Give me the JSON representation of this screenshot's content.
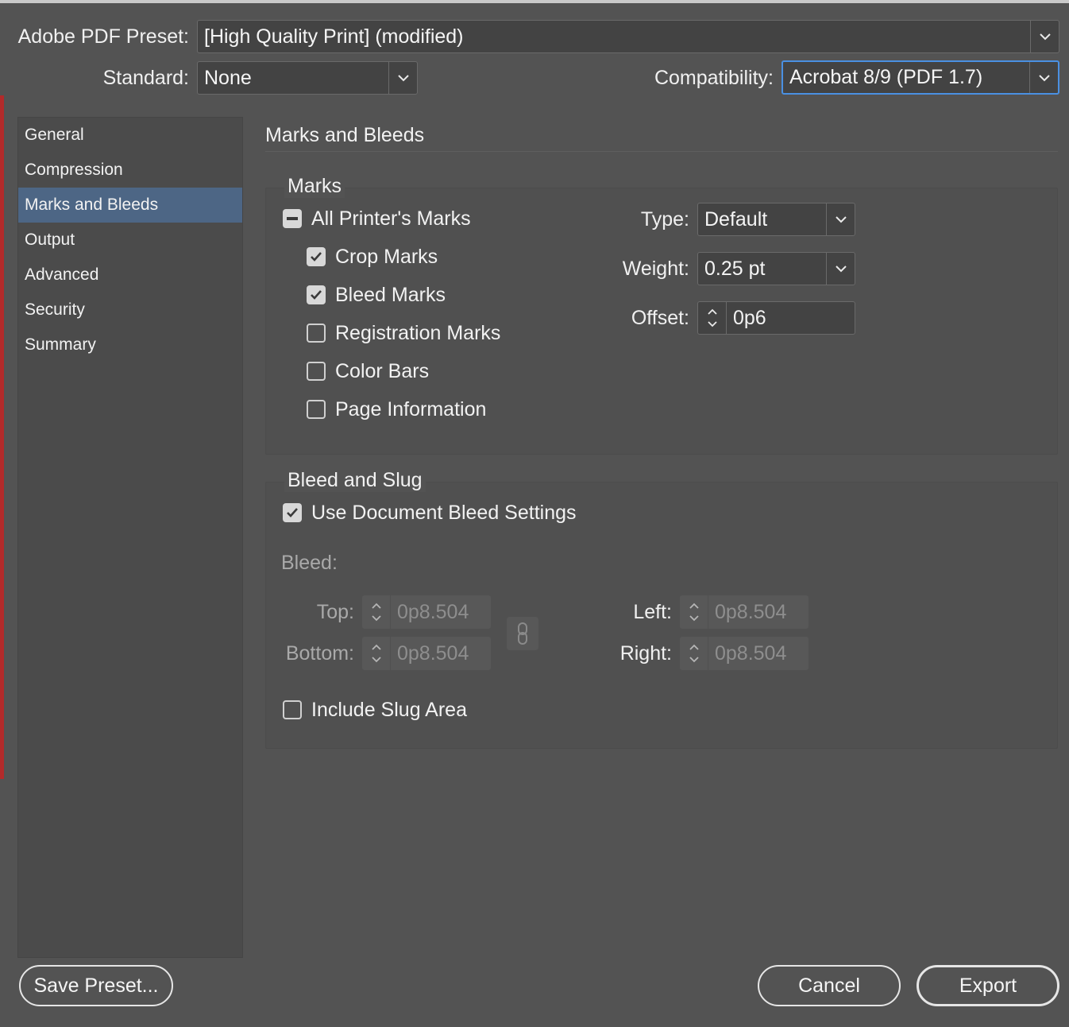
{
  "header": {
    "preset_label": "Adobe PDF Preset:",
    "preset_value": "[High Quality Print] (modified)",
    "standard_label": "Standard:",
    "standard_value": "None",
    "compat_label": "Compatibility:",
    "compat_value": "Acrobat 8/9 (PDF 1.7)"
  },
  "sidebar": {
    "items": [
      {
        "label": "General"
      },
      {
        "label": "Compression"
      },
      {
        "label": "Marks and Bleeds",
        "selected": true
      },
      {
        "label": "Output"
      },
      {
        "label": "Advanced"
      },
      {
        "label": "Security"
      },
      {
        "label": "Summary"
      }
    ]
  },
  "main": {
    "section_title": "Marks and Bleeds",
    "marks": {
      "title": "Marks",
      "all_printers_marks": {
        "label": "All Printer's Marks",
        "state": "mixed"
      },
      "items": [
        {
          "label": "Crop Marks",
          "checked": true
        },
        {
          "label": "Bleed Marks",
          "checked": true
        },
        {
          "label": "Registration Marks",
          "checked": false
        },
        {
          "label": "Color Bars",
          "checked": false
        },
        {
          "label": "Page Information",
          "checked": false
        }
      ],
      "type_label": "Type:",
      "type_value": "Default",
      "weight_label": "Weight:",
      "weight_value": "0.25 pt",
      "offset_label": "Offset:",
      "offset_value": "0p6"
    },
    "bleed_slug": {
      "title": "Bleed and Slug",
      "use_doc_bleed": {
        "label": "Use Document Bleed Settings",
        "checked": true
      },
      "bleed_label": "Bleed:",
      "top_label": "Top:",
      "top_value": "0p8.504",
      "bottom_label": "Bottom:",
      "bottom_value": "0p8.504",
      "left_label": "Left:",
      "left_value": "0p8.504",
      "right_label": "Right:",
      "right_value": "0p8.504",
      "include_slug": {
        "label": "Include Slug Area",
        "checked": false
      }
    }
  },
  "footer": {
    "save_preset": "Save Preset...",
    "cancel": "Cancel",
    "export": "Export"
  },
  "colors": {
    "background": "#535353",
    "selection": "#4d6685",
    "focus": "#4a90e2"
  }
}
